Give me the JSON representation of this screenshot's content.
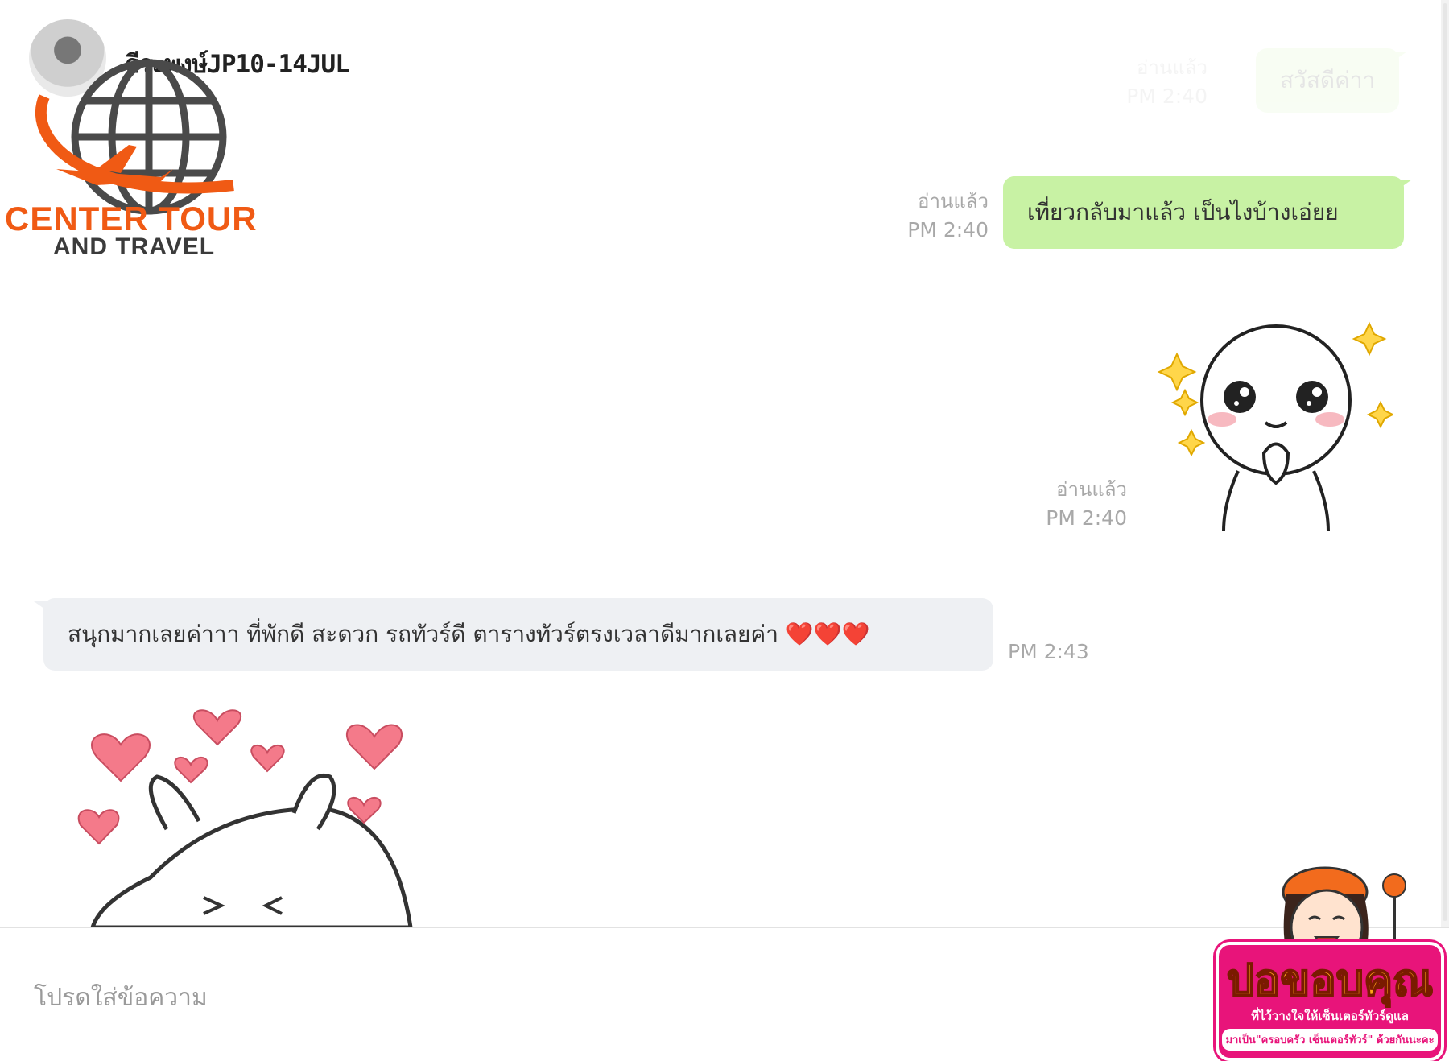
{
  "header": {
    "contact_name": "ธีระพงษ์JP10-14JUL"
  },
  "logo": {
    "line1": "CENTER TOUR",
    "line2": "AND TRAVEL"
  },
  "messages": [
    {
      "direction": "out",
      "type": "text",
      "text": "สวัสดีค่าา",
      "read": "อ่านแล้ว",
      "time": "PM 2:40"
    },
    {
      "direction": "out",
      "type": "text",
      "text": "เที่ยวกลับมาแล้ว เป็นไงบ้างเอ่ยย",
      "read": "อ่านแล้ว",
      "time": "PM 2:40"
    },
    {
      "direction": "out",
      "type": "sticker",
      "sticker": "moon-pleading-sticker",
      "read": "อ่านแล้ว",
      "time": "PM 2:40"
    },
    {
      "direction": "in",
      "type": "text",
      "text": "สนุกมากเลยค่าาา ที่พักดี สะดวก รถทัวร์ดี ตารางทัวร์ตรงเวลาดีมากเลยค่า ❤️❤️❤️",
      "time": "PM 2:43"
    },
    {
      "direction": "in",
      "type": "sticker",
      "sticker": "cony-hearts-sticker"
    }
  ],
  "composer": {
    "placeholder": "โปรดใส่ข้อความ"
  },
  "banner": {
    "title": "ปอขอบคุณ",
    "subtitle": "ที่ไว้วางใจให้เซ็นเตอร์ทัวร์ดูแล",
    "tagline": "มาเป็น\"ครอบครัว เซ็นเตอร์ทัวร์\" ด้วยกันนะคะ"
  },
  "colors": {
    "outgoing_bubble": "#c8f2a4",
    "incoming_bubble": "#eef0f3",
    "brand_orange": "#f05a14",
    "banner_pink": "#e8147a"
  }
}
